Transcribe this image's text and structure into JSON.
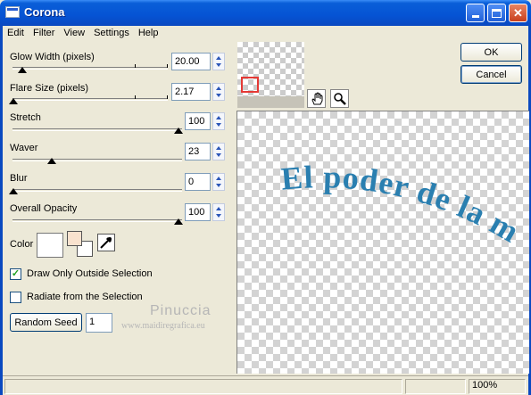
{
  "window": {
    "title": "Corona"
  },
  "menu": [
    "Edit",
    "Filter",
    "View",
    "Settings",
    "Help"
  ],
  "controls": {
    "glow_width": {
      "label": "Glow Width (pixels)",
      "value": "20.00"
    },
    "flare_size": {
      "label": "Flare Size (pixels)",
      "value": "2.17"
    },
    "stretch": {
      "label": "Stretch",
      "value": "100"
    },
    "waver": {
      "label": "Waver",
      "value": "23"
    },
    "blur": {
      "label": "Blur",
      "value": "0"
    },
    "opacity": {
      "label": "Overall Opacity",
      "value": "100"
    }
  },
  "color": {
    "label": "Color",
    "primary": "#ffffff",
    "secondary": "#f9e2ce"
  },
  "checkboxes": {
    "outside": {
      "label": "Draw Only Outside Selection",
      "checked": true
    },
    "radiate": {
      "label": "Radiate from the Selection",
      "checked": false
    }
  },
  "seed": {
    "button": "Random Seed",
    "value": "1"
  },
  "buttons": {
    "ok": "OK",
    "cancel": "Cancel"
  },
  "tools": {
    "hand": "hand-icon",
    "zoom": "magnifier-icon"
  },
  "preview": {
    "text": "El poder de la m",
    "text_color": "#2a7fb0"
  },
  "watermark": {
    "name": "Pinuccia",
    "url": "www.maidiregrafica.eu"
  },
  "status": {
    "zoom": "100%"
  }
}
